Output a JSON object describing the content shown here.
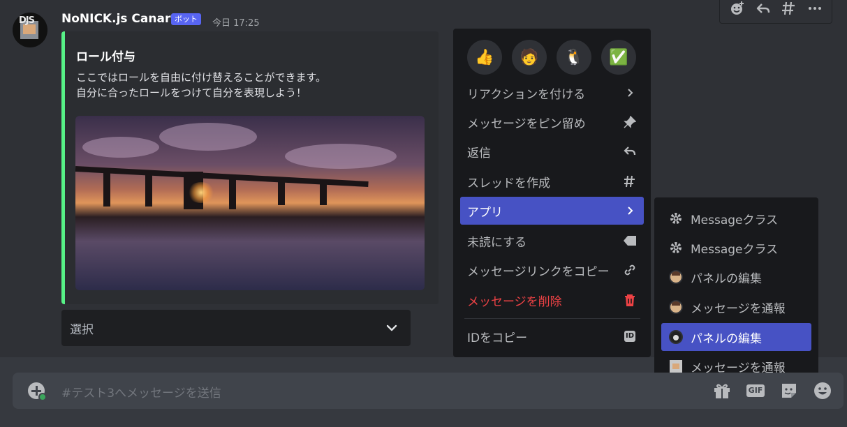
{
  "message": {
    "username": "NoNICK.js Canary",
    "bot_tag": "ボット",
    "timestamp": "今日 17:25",
    "avatar_text": "DJS",
    "embed": {
      "accent_color": "#57f287",
      "title": "ロール付与",
      "description_line1": "ここではロールを自由に付け替えることができます。",
      "description_line2": "自分に合ったロールをつけて自分を表現しよう！"
    },
    "select": {
      "placeholder": "選択"
    }
  },
  "hover_bar": {
    "icons": [
      "add-reaction-icon",
      "reply-icon",
      "thread-icon",
      "more-icon"
    ]
  },
  "context_menu": {
    "quick_reactions": [
      "👍",
      "🧑",
      "🐧",
      "✅"
    ],
    "items": [
      {
        "label": "リアクションを付ける",
        "icon": "chevron-right-icon"
      },
      {
        "label": "メッセージをピン留め",
        "icon": "pin-icon"
      },
      {
        "label": "返信",
        "icon": "reply-icon"
      },
      {
        "label": "スレッドを作成",
        "icon": "thread-icon"
      },
      {
        "label": "アプリ",
        "icon": "chevron-right-icon",
        "active": true
      },
      {
        "label": "未読にする",
        "icon": "tag-icon"
      },
      {
        "label": "メッセージリンクをコピー",
        "icon": "link-icon"
      },
      {
        "label": "メッセージを削除",
        "icon": "trash-icon",
        "danger": true
      },
      {
        "label": "IDをコピー",
        "icon": "id-icon"
      }
    ]
  },
  "apps_submenu": {
    "items": [
      {
        "label": "Messageクラス",
        "icon": "gear-icon"
      },
      {
        "label": "Messageクラス",
        "icon": "gear-icon"
      },
      {
        "label": "パネルの編集",
        "icon": "app-avatar-icon"
      },
      {
        "label": "メッセージを通報",
        "icon": "app-avatar-icon"
      },
      {
        "label": "パネルの編集",
        "icon": "app-avatar-icon",
        "active": true
      },
      {
        "label": "メッセージを通報",
        "icon": "app-avatar-icon"
      }
    ]
  },
  "composer": {
    "placeholder": "#テスト3へメッセージを送信",
    "gif_label": "GIF"
  },
  "colors": {
    "accent": "#4752c4",
    "danger": "#ed4245",
    "background": "#36393f",
    "menu_bg": "#18191c"
  }
}
